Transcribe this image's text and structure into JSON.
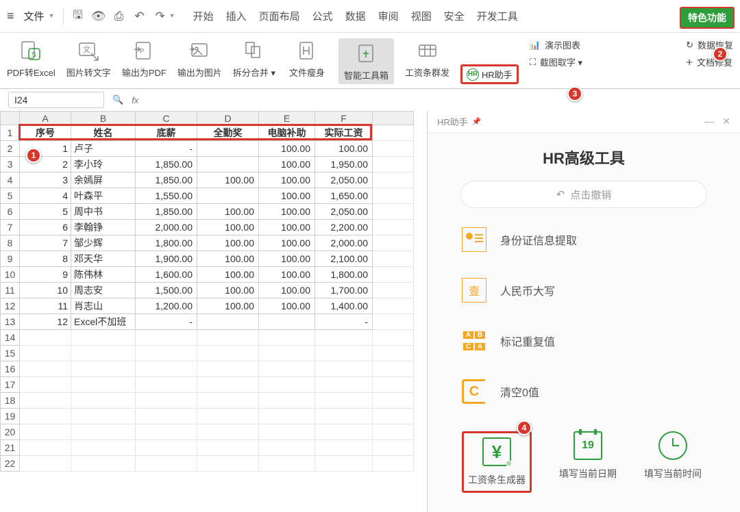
{
  "top": {
    "file": "文件",
    "tabs": [
      "开始",
      "插入",
      "页面布局",
      "公式",
      "数据",
      "审阅",
      "视图",
      "安全",
      "开发工具"
    ],
    "special": "特色功能"
  },
  "ribbon": {
    "pdf_excel": "PDF转Excel",
    "img_text": "图片转文字",
    "out_pdf": "输出为PDF",
    "out_img": "输出为图片",
    "split_merge": "拆分合并",
    "file_slim": "文件瘦身",
    "smart_box": "智能工具箱",
    "salary_send": "工资条群发",
    "hr_assist": "HR助手",
    "screenshot": "截图取字",
    "demo_chart": "演示图表",
    "data_recover": "数据恢复",
    "doc_repair": "文档修复"
  },
  "formula": {
    "cell": "I24",
    "fx": "fx"
  },
  "cols": [
    "A",
    "B",
    "C",
    "D",
    "E",
    "F"
  ],
  "headers": [
    "序号",
    "姓名",
    "底薪",
    "全勤奖",
    "电脑补助",
    "实际工资"
  ],
  "rows": [
    {
      "n": "1",
      "name": "卢子",
      "base": "-",
      "full": "",
      "pc": "100.00",
      "real": "100.00"
    },
    {
      "n": "2",
      "name": "李小玲",
      "base": "1,850.00",
      "full": "",
      "pc": "100.00",
      "real": "1,950.00"
    },
    {
      "n": "3",
      "name": "余嫣屏",
      "base": "1,850.00",
      "full": "100.00",
      "pc": "100.00",
      "real": "2,050.00"
    },
    {
      "n": "4",
      "name": "叶森平",
      "base": "1,550.00",
      "full": "",
      "pc": "100.00",
      "real": "1,650.00"
    },
    {
      "n": "5",
      "name": "周中书",
      "base": "1,850.00",
      "full": "100.00",
      "pc": "100.00",
      "real": "2,050.00"
    },
    {
      "n": "6",
      "name": "李翰铮",
      "base": "2,000.00",
      "full": "100.00",
      "pc": "100.00",
      "real": "2,200.00"
    },
    {
      "n": "7",
      "name": "邹少辉",
      "base": "1,800.00",
      "full": "100.00",
      "pc": "100.00",
      "real": "2,000.00"
    },
    {
      "n": "8",
      "name": "邓天华",
      "base": "1,900.00",
      "full": "100.00",
      "pc": "100.00",
      "real": "2,100.00"
    },
    {
      "n": "9",
      "name": "陈伟林",
      "base": "1,600.00",
      "full": "100.00",
      "pc": "100.00",
      "real": "1,800.00"
    },
    {
      "n": "10",
      "name": "周志安",
      "base": "1,500.00",
      "full": "100.00",
      "pc": "100.00",
      "real": "1,700.00"
    },
    {
      "n": "11",
      "name": "肖志山",
      "base": "1,200.00",
      "full": "100.00",
      "pc": "100.00",
      "real": "1,400.00"
    },
    {
      "n": "12",
      "name": "Excel不加班",
      "base": "-",
      "full": "",
      "pc": "",
      "real": "-"
    }
  ],
  "panel": {
    "pane_title": "HR助手",
    "title": "HR高级工具",
    "undo": "点击撤销",
    "tools": {
      "id_extract": "身份证信息提取",
      "rmb_upper": "人民币大写",
      "mark_dup": "标记重复值",
      "clear_zero": "清空0值",
      "grid_letters": [
        "A",
        "B",
        "C",
        "A"
      ]
    },
    "bottom": {
      "salary": "工资条生成器",
      "date": "填写当前日期",
      "date_num": "19",
      "time": "填写当前时间"
    }
  },
  "badges": {
    "1": "1",
    "2": "2",
    "3": "3",
    "4": "4"
  }
}
